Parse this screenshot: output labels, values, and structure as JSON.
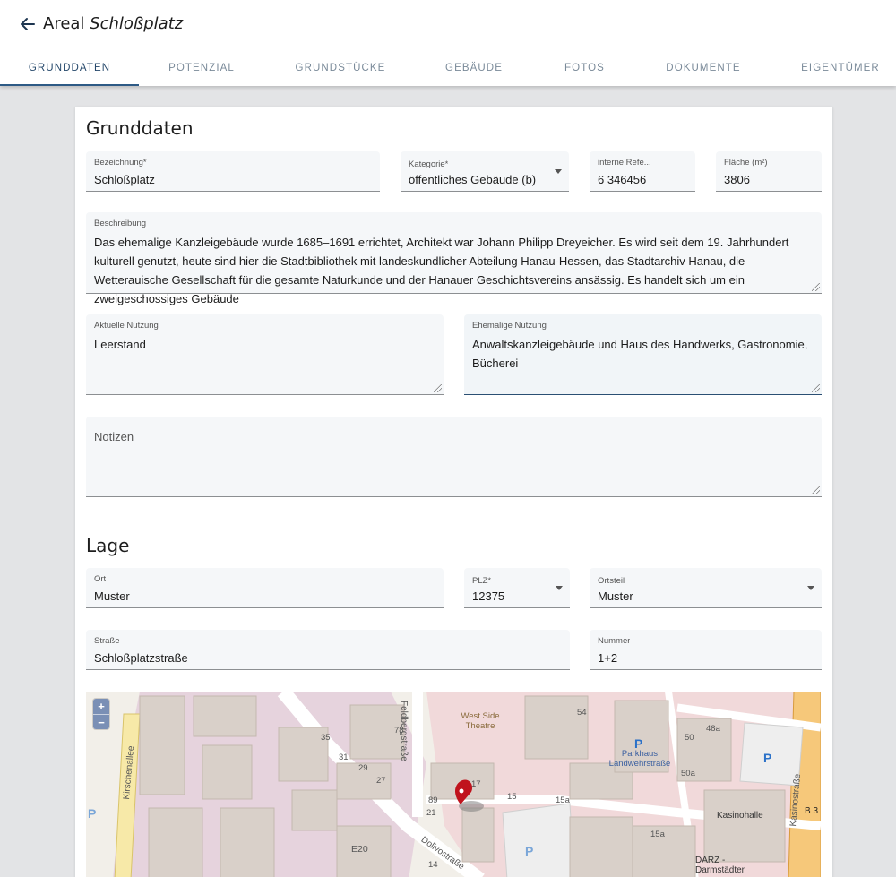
{
  "header": {
    "title_prefix": "Areal",
    "title_name": "Schloßplatz",
    "back_icon": "arrow-left-icon"
  },
  "tabs": [
    {
      "label": "GRUNDDATEN",
      "active": true
    },
    {
      "label": "POTENZIAL",
      "active": false
    },
    {
      "label": "GRUNDSTÜCKE",
      "active": false
    },
    {
      "label": "GEBÄUDE",
      "active": false
    },
    {
      "label": "FOTOS",
      "active": false
    },
    {
      "label": "DOKUMENTE",
      "active": false
    },
    {
      "label": "EIGENTÜMER",
      "active": false
    }
  ],
  "grunddaten": {
    "title": "Grunddaten",
    "bezeichnung": {
      "label": "Bezeichnung*",
      "value": "Schloßplatz"
    },
    "kategorie": {
      "label": "Kategorie*",
      "value": "öffentliches Gebäude (b)"
    },
    "referenz": {
      "label": "interne Refe...",
      "value": "6  346456"
    },
    "flaeche": {
      "label": "Fläche (m²)",
      "value": "3806"
    },
    "beschreibung": {
      "label": "Beschreibung",
      "value": "Das ehemalige Kanzleigebäude wurde 1685–1691 errichtet, Architekt war Johann Philipp Dreyeicher. Es wird seit dem 19. Jahrhundert kulturell genutzt, heute sind hier die Stadtbibliothek mit landeskundlicher Abteilung Hanau-Hessen, das Stadtarchiv Hanau, die Wetterauische Gesellschaft für die gesamte Naturkunde und der Hanauer Geschichtsvereins ansässig. Es handelt sich um ein zweigeschossiges Gebäude"
    },
    "aktuelle_nutzung": {
      "label": "Aktuelle Nutzung",
      "value": "Leerstand"
    },
    "ehemalige_nutzung": {
      "label": "Ehemalige Nutzung",
      "value": "Anwaltskanzleigebäude und Haus des Handwerks, Gastronomie, Bücherei"
    },
    "notizen": {
      "placeholder": "Notizen"
    }
  },
  "lage": {
    "title": "Lage",
    "ort": {
      "label": "Ort",
      "value": "Muster"
    },
    "plz": {
      "label": "PLZ*",
      "value": "12375"
    },
    "ortsteil": {
      "label": "Ortsteil",
      "value": "Muster"
    },
    "strasse": {
      "label": "Straße",
      "value": "Schloßplatzstraße"
    },
    "nummer": {
      "label": "Nummer",
      "value": "1+2"
    }
  },
  "map": {
    "zoom_in": "+",
    "zoom_out": "−",
    "street_kirschenallee": "Kirschenallee",
    "street_feldbergstrasse": "Feldbergstraße",
    "street_dolivostrasse": "Dolivostraße",
    "street_kasinostrasse": "Kasinostraße",
    "poi_theatre": "West Side Theatre",
    "poi_parkhaus": "Parkhaus Landwehrstraße",
    "poi_kasinohalle": "Kasinohalle",
    "poi_darz": "DARZ - Darmstädter",
    "road_b3": "B 3",
    "parking_symbol": "P",
    "numbers": {
      "n35": "35",
      "n31": "31",
      "n29": "29",
      "n27": "27",
      "n78": "78",
      "n17": "17",
      "n89": "89",
      "n21": "21",
      "n14": "14",
      "n15": "15",
      "n15a": "15a",
      "n15a2": "15a",
      "n54": "54",
      "n48a": "48a",
      "n50": "50",
      "n50a": "50a",
      "e20": "E20"
    },
    "colors": {
      "land": "#f2efe9",
      "building": "#d9d0c9",
      "residential": "#e6d3dd",
      "commercial": "#f1d9da",
      "parking": "#eeeeee",
      "marker": "#c0131d"
    }
  }
}
